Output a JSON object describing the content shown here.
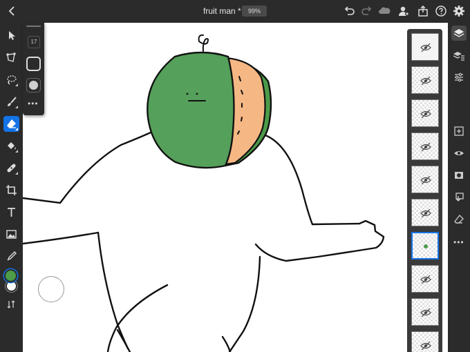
{
  "app": {
    "doc_title": "fruit man *",
    "zoom": "99%"
  },
  "brush_panel": {
    "size": "17",
    "more": "•••"
  },
  "colors": {
    "primary": "#4c9c4a",
    "secondary": "#ffffff",
    "accent": "#1473e6",
    "melon_green": "#55a05a",
    "melon_flesh": "#f5b784"
  },
  "left_tools": [
    "selection-tool",
    "transform-tool",
    "lasso-tool",
    "brush-tool",
    "eraser-tool",
    "fill-tool",
    "healing-tool",
    "crop-tool",
    "type-tool",
    "image-tool",
    "eyedropper-tool"
  ],
  "layers": [
    {
      "name": "layer-1",
      "visible": false
    },
    {
      "name": "layer-2",
      "visible": false
    },
    {
      "name": "layer-3",
      "visible": false
    },
    {
      "name": "layer-4",
      "visible": false
    },
    {
      "name": "layer-5",
      "visible": false
    },
    {
      "name": "layer-6",
      "visible": false
    },
    {
      "name": "layer-7",
      "visible": true,
      "selected": true
    },
    {
      "name": "layer-8",
      "visible": false
    },
    {
      "name": "layer-9",
      "visible": false
    },
    {
      "name": "layer-10",
      "visible": false
    }
  ]
}
